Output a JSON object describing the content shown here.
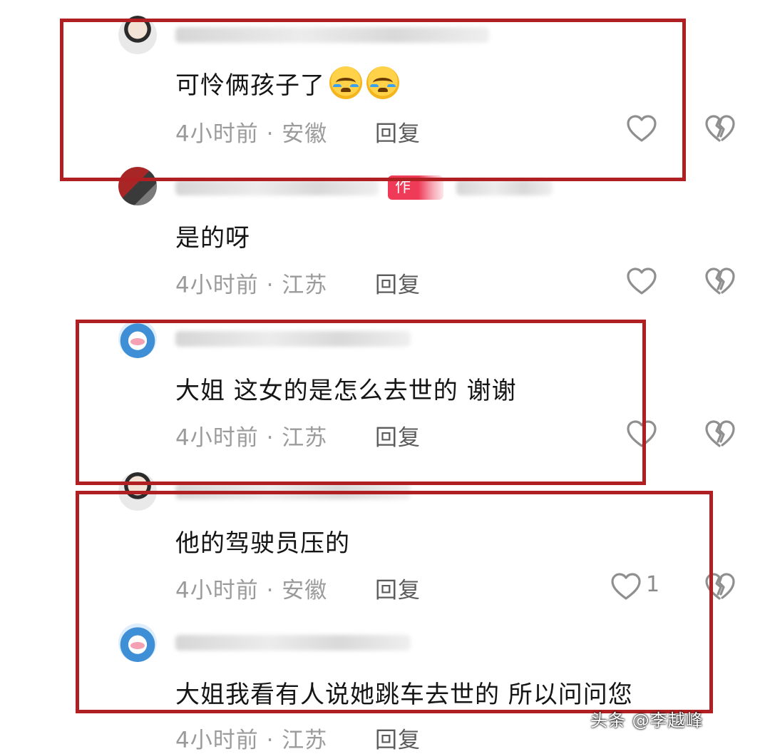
{
  "comments": [
    {
      "text": "可怜俩孩子了",
      "emoji": [
        "loudly-crying-face",
        "loudly-crying-face"
      ],
      "time_location": "4小时前 · 安徽",
      "reply_label": "回复",
      "likes": ""
    },
    {
      "author_badge": "作",
      "text": "是的呀",
      "time_location": "4小时前 · 江苏",
      "reply_label": "回复",
      "likes": ""
    },
    {
      "text": "大姐 这女的是怎么去世的  谢谢",
      "time_location": "4小时前 · 江苏",
      "reply_label": "回复",
      "likes": ""
    },
    {
      "text": "他的驾驶员压的",
      "time_location": "4小时前 · 安徽",
      "reply_label": "回复",
      "likes": "1"
    },
    {
      "text": "大姐我看有人说她跳车去世的  所以问问您",
      "time_location": "4小时前 · 江苏",
      "reply_label": "回复",
      "likes": ""
    }
  ],
  "icons": {
    "like": "heart-outline-icon",
    "dislike": "broken-heart-icon"
  },
  "watermark": "头条 @李越峰"
}
